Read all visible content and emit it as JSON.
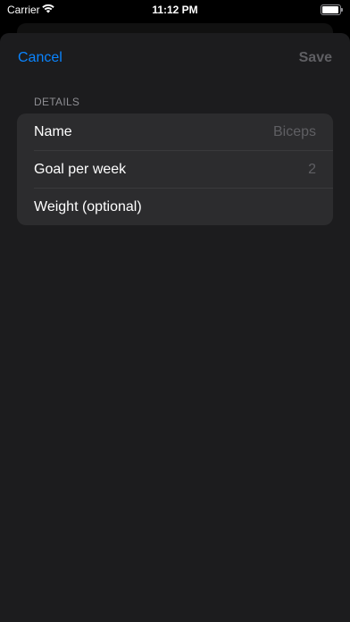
{
  "status_bar": {
    "carrier": "Carrier",
    "time": "11:12 PM"
  },
  "nav": {
    "cancel_label": "Cancel",
    "save_label": "Save"
  },
  "details": {
    "header": "DETAILS",
    "rows": [
      {
        "label": "Name",
        "value": "Biceps"
      },
      {
        "label": "Goal per week",
        "value": "2"
      },
      {
        "label": "Weight (optional)",
        "value": ""
      }
    ]
  },
  "colors": {
    "accent": "#0a84ff",
    "background": "#1c1c1e",
    "group_background": "#2c2c2e",
    "placeholder": "#5f5f63"
  }
}
